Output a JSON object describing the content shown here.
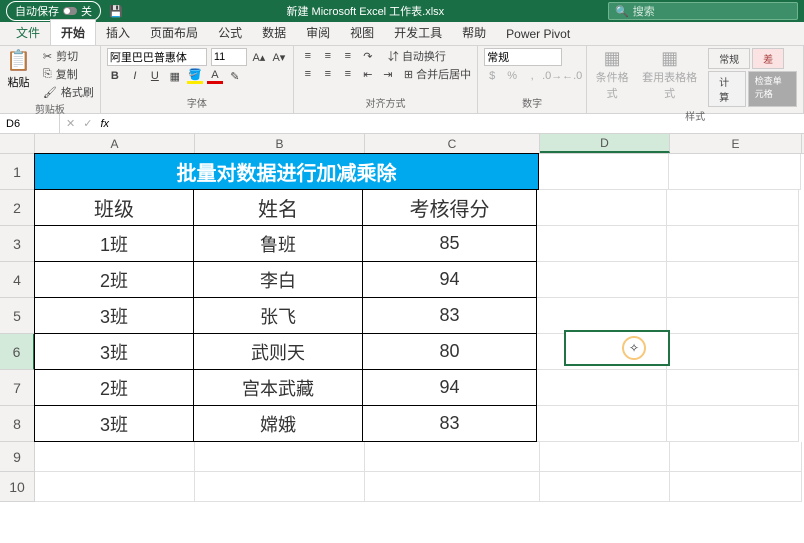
{
  "titlebar": {
    "autosave_label": "自动保存",
    "autosave_toggle": "关",
    "filename": "新建 Microsoft Excel 工作表.xlsx",
    "search_placeholder": "搜索"
  },
  "tabs": {
    "file": "文件",
    "home": "开始",
    "insert": "插入",
    "layout": "页面布局",
    "formulas": "公式",
    "data": "数据",
    "review": "审阅",
    "view": "视图",
    "dev": "开发工具",
    "help": "帮助",
    "powerpivot": "Power Pivot"
  },
  "ribbon": {
    "clipboard": {
      "paste": "粘贴",
      "cut": "剪切",
      "copy": "复制",
      "format_painter": "格式刷",
      "label": "剪贴板"
    },
    "font": {
      "name": "阿里巴巴普惠体",
      "size": "11",
      "label": "字体"
    },
    "alignment": {
      "wrap": "自动换行",
      "merge": "合并后居中",
      "label": "对齐方式"
    },
    "number": {
      "general": "常规",
      "label": "数字"
    },
    "styles": {
      "cond_format": "条件格式",
      "table_format": "套用表格格式",
      "style_general": "常规",
      "style_bad": "差",
      "style_calc": "计算",
      "style_check": "检查单元格",
      "label": "样式"
    }
  },
  "formula_bar": {
    "cell_ref": "D6",
    "fx_label": "fx",
    "value": ""
  },
  "columns": [
    "A",
    "B",
    "C",
    "D",
    "E"
  ],
  "row_labels": [
    "1",
    "2",
    "3",
    "4",
    "5",
    "6",
    "7",
    "8",
    "9",
    "10"
  ],
  "table": {
    "title": "批量对数据进行加减乘除",
    "headers": {
      "class": "班级",
      "name": "姓名",
      "score": "考核得分"
    },
    "rows": [
      {
        "class": "1班",
        "name": "鲁班",
        "score": "85"
      },
      {
        "class": "2班",
        "name": "李白",
        "score": "94"
      },
      {
        "class": "3班",
        "name": "张飞",
        "score": "83"
      },
      {
        "class": "3班",
        "name": "武则天",
        "score": "80"
      },
      {
        "class": "2班",
        "name": "宫本武藏",
        "score": "94"
      },
      {
        "class": "3班",
        "name": "嫦娥",
        "score": "83"
      }
    ]
  },
  "chart_data": {
    "type": "table",
    "title": "批量对数据进行加减乘除",
    "columns": [
      "班级",
      "姓名",
      "考核得分"
    ],
    "rows": [
      [
        "1班",
        "鲁班",
        85
      ],
      [
        "2班",
        "李白",
        94
      ],
      [
        "3班",
        "张飞",
        83
      ],
      [
        "3班",
        "武则天",
        80
      ],
      [
        "2班",
        "宫本武藏",
        94
      ],
      [
        "3班",
        "嫦娥",
        83
      ]
    ]
  }
}
